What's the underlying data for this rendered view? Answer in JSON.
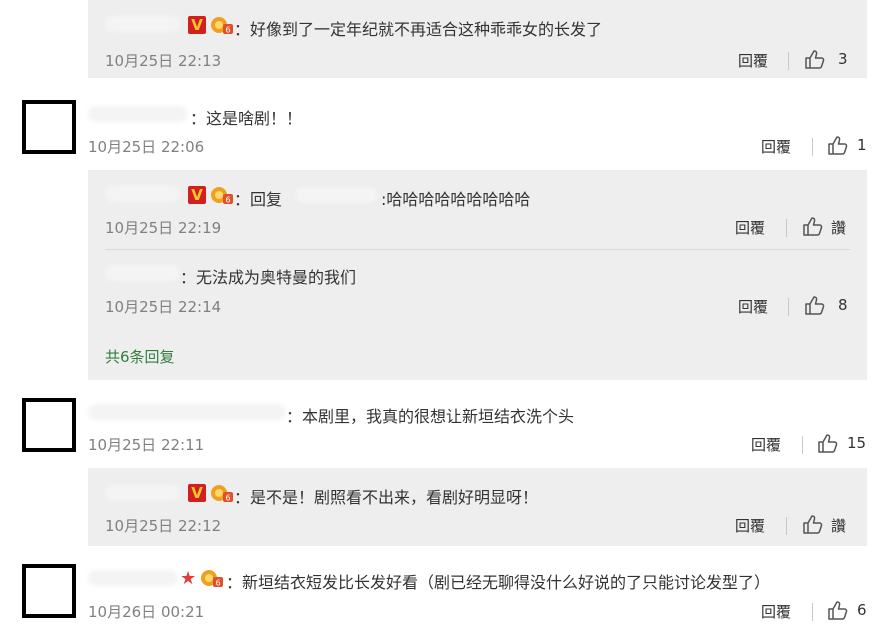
{
  "comments": [
    {
      "reply": {
        "text": "：好像到了一定年纪就不再适合这种乖乖女的长发了",
        "time": "10月25日 22:13",
        "reply_label": "回覆",
        "likes": "3"
      }
    },
    {
      "text": "：这是啥剧！！",
      "time": "10月25日 22:06",
      "reply_label": "回覆",
      "likes": "1",
      "replies": [
        {
          "text_prefix": "：回复",
          "text": ":哈哈哈哈哈哈哈哈哈",
          "time": "10月25日 22:19",
          "reply_label": "回覆",
          "likes": "讚"
        },
        {
          "text": "：无法成为奥特曼的我们",
          "time": "10月25日 22:14",
          "reply_label": "回覆",
          "likes": "8"
        }
      ],
      "more_replies": "共6条回复"
    },
    {
      "text": "：本剧里，我真的很想让新垣结衣洗个头",
      "time": "10月25日 22:11",
      "reply_label": "回覆",
      "likes": "15",
      "replies": [
        {
          "text": "：是不是！剧照看不出来，看剧好明显呀！",
          "time": "10月25日 22:12",
          "reply_label": "回覆",
          "likes": "讚"
        }
      ]
    },
    {
      "text": "：新垣结衣短发比长发好看（剧已经无聊得没什么好说的了只能讨论发型了）",
      "time": "10月26日 00:21",
      "reply_label": "回覆",
      "likes": "6"
    }
  ],
  "colors": {
    "reply_bg": "#eeeeee",
    "link_green": "#2f7f3f",
    "timestamp_gray": "#808080",
    "badge_red": "#d21f1f"
  },
  "icons": [
    "like-icon",
    "verified-v-icon",
    "level-badge-icon",
    "avatar"
  ]
}
